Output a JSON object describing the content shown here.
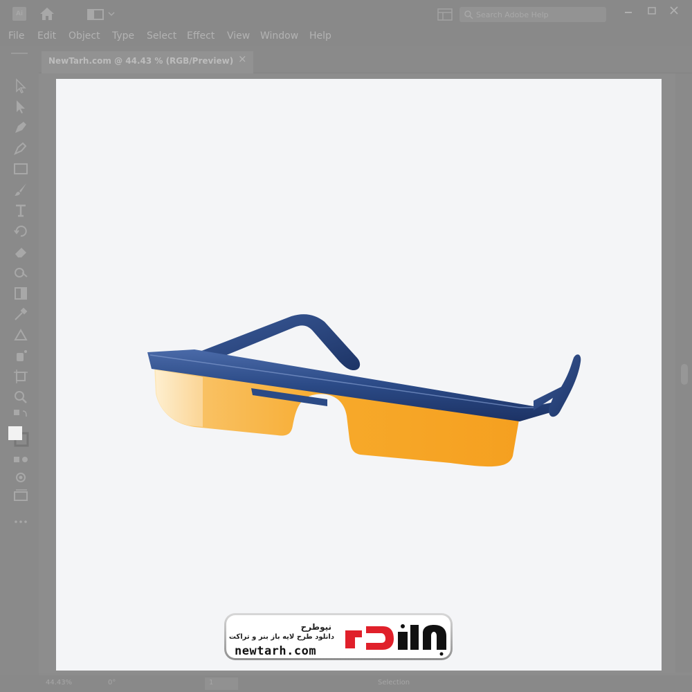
{
  "titlebar": {
    "app_logo": "Ai",
    "search_placeholder": "Search Adobe Help"
  },
  "menu": {
    "items": [
      "File",
      "Edit",
      "Object",
      "Type",
      "Select",
      "Effect",
      "View",
      "Window",
      "Help"
    ]
  },
  "tab": {
    "label": "NewTarh.com @ 44.43 % (RGB/Preview)",
    "close": "×"
  },
  "status": {
    "zoom": "44.43%",
    "angle": "0°",
    "page": "1",
    "mode": "Selection"
  },
  "watermark": {
    "title": "نیوطرح",
    "subtitle": "دانلود طرح لایه باز بنر و تراکت",
    "url": "newtarh.com",
    "logo_text": "نیوطرح"
  },
  "colors": {
    "frame_blue": "#2b4a86",
    "lens_orange": "#f7a827",
    "logo_red": "#e0202a"
  }
}
